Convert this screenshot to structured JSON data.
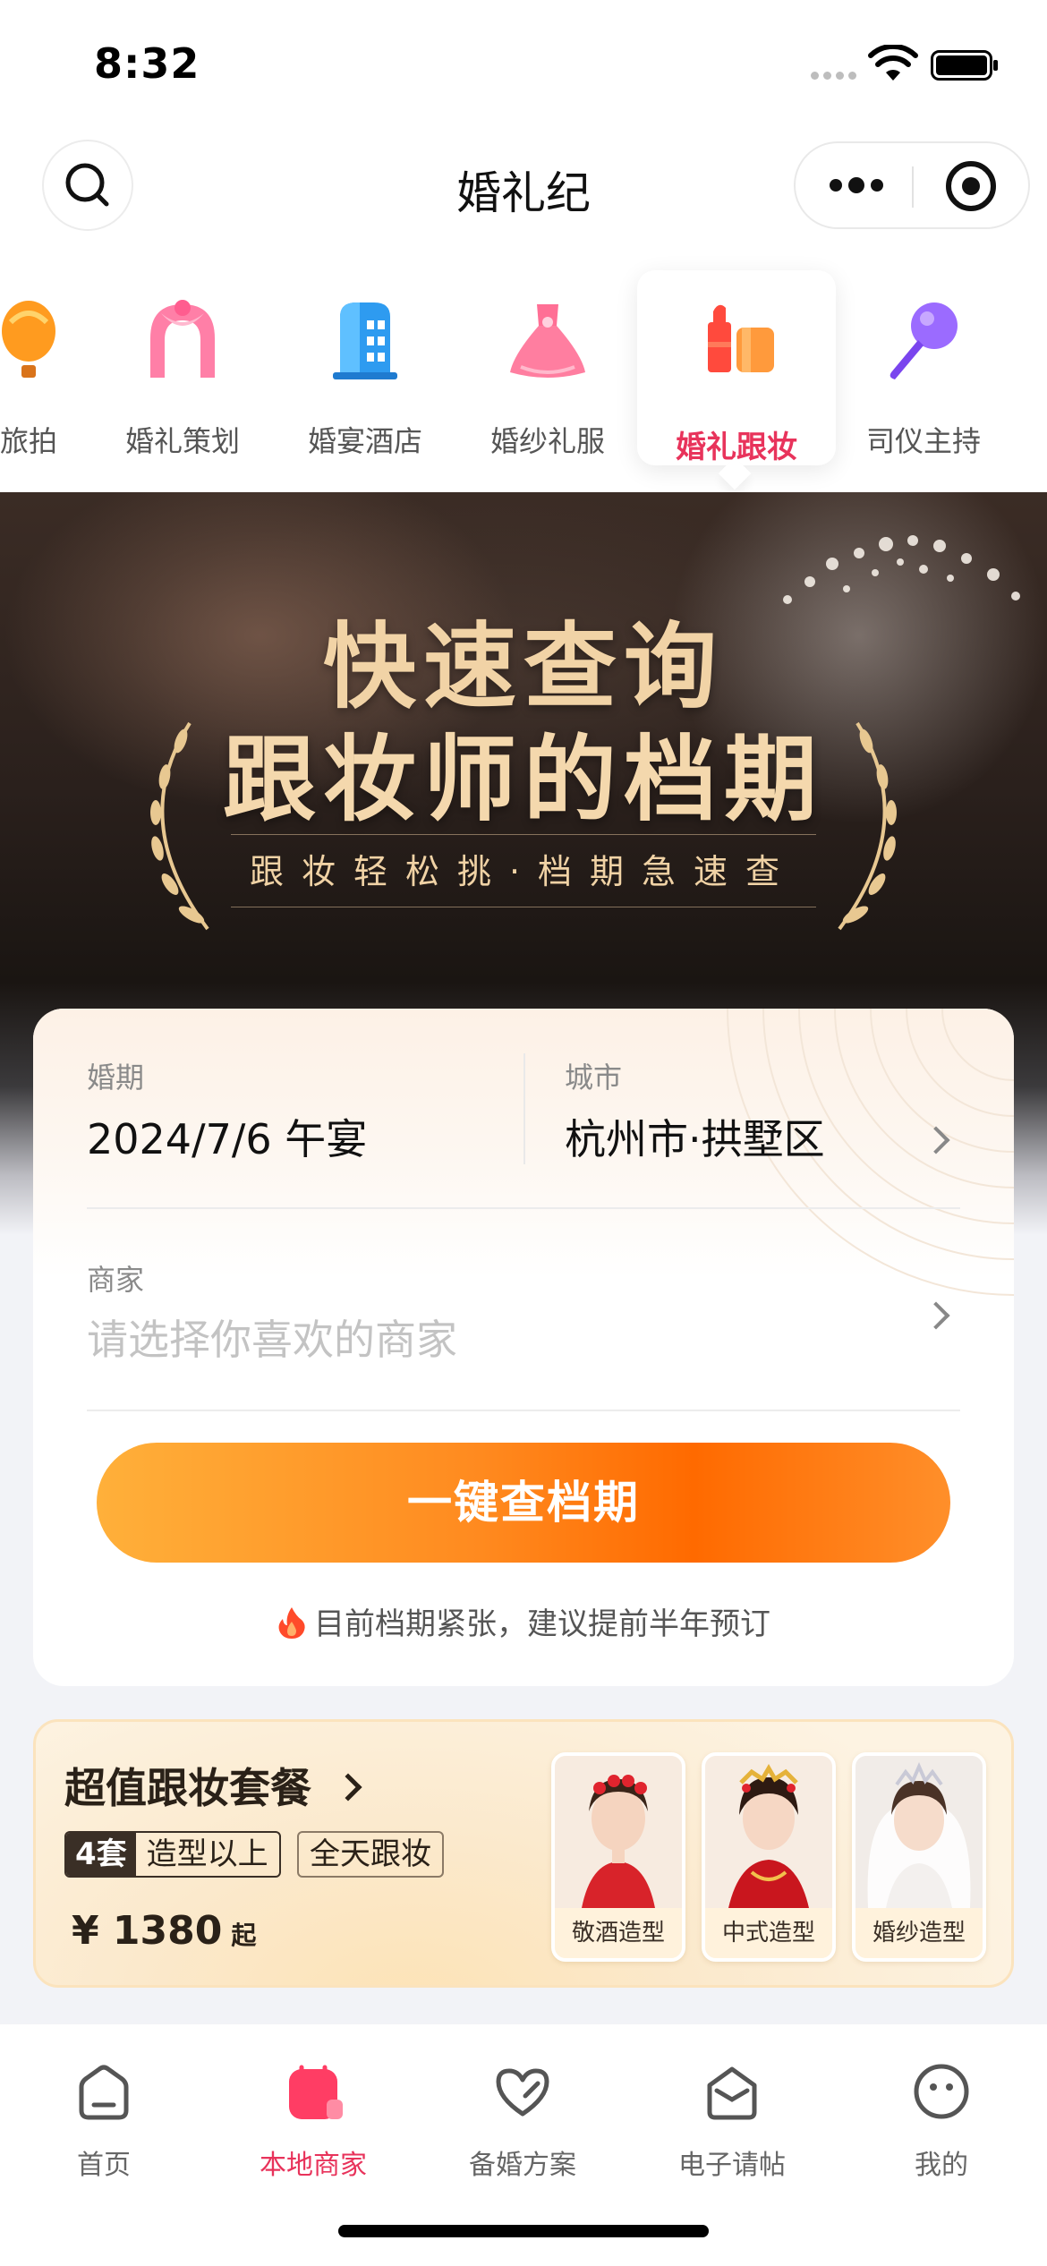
{
  "status_bar": {
    "time": "8:32"
  },
  "nav": {
    "title": "婚礼纪"
  },
  "categories": [
    {
      "label": "旅拍",
      "icon": "hot-air-balloon-icon"
    },
    {
      "label": "婚礼策划",
      "icon": "arch-icon"
    },
    {
      "label": "婚宴酒店",
      "icon": "hotel-building-icon"
    },
    {
      "label": "婚纱礼服",
      "icon": "dress-icon"
    },
    {
      "label": "婚礼跟妆",
      "icon": "lipstick-icon",
      "active": true
    },
    {
      "label": "司仪主持",
      "icon": "microphone-icon"
    }
  ],
  "hero": {
    "title_line1": "快速查询",
    "title_line2": "跟妆师的档期",
    "subtitle": "跟妆轻松挑·档期急速查"
  },
  "query": {
    "date_label": "婚期",
    "date_value": "2024/7/6 午宴",
    "city_label": "城市",
    "city_value": "杭州市·拱墅区",
    "merchant_label": "商家",
    "merchant_placeholder": "请选择你喜欢的商家",
    "button_label": "一键查档期",
    "tip": "目前档期紧张，建议提前半年预订"
  },
  "package": {
    "title": "超值跟妆套餐",
    "count": "4套",
    "count_tag": "造型以上",
    "tag2": "全天跟妆",
    "price": "¥ 1380",
    "price_suffix": "起",
    "styles": [
      {
        "label": "敬酒造型"
      },
      {
        "label": "中式造型"
      },
      {
        "label": "婚纱造型"
      }
    ]
  },
  "tabbar": [
    {
      "label": "首页",
      "icon": "home-icon"
    },
    {
      "label": "本地商家",
      "icon": "shop-icon",
      "active": true
    },
    {
      "label": "备婚方案",
      "icon": "heart-icon"
    },
    {
      "label": "电子请帖",
      "icon": "envelope-icon"
    },
    {
      "label": "我的",
      "icon": "smiley-icon"
    }
  ],
  "colors": {
    "accent": "#e8335b",
    "button_start": "#ffb03a",
    "button_end": "#ff6a00",
    "gold": "#f1d3a6"
  }
}
